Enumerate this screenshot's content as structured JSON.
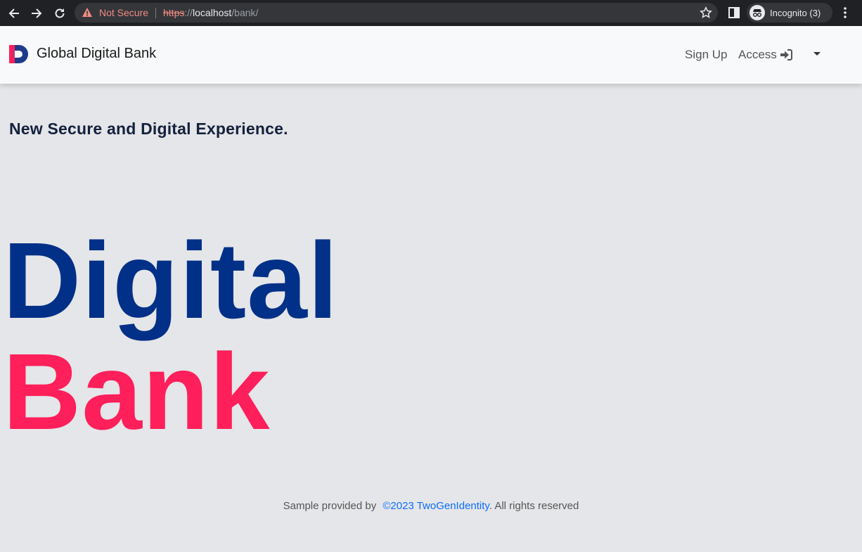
{
  "browser": {
    "security_label": "Not Secure",
    "url_scheme": "https",
    "url_sep": "://",
    "url_host": "localhost",
    "url_path": "/bank/",
    "profile_label": "Incognito (3)"
  },
  "navbar": {
    "brand": "Global Digital Bank",
    "signup_label": "Sign Up",
    "access_label": "Access"
  },
  "hero": {
    "tagline": "New Secure and Digital Experience.",
    "line1": "Digital",
    "line2": "Bank"
  },
  "footer": {
    "prefix": "Sample provided by",
    "link_text": "©2023 TwoGenIdentity",
    "suffix": ". All rights reserved"
  },
  "colors": {
    "brand_blue": "#003087",
    "brand_pink": "#ff1f5a",
    "link_blue": "#0d6efd"
  }
}
